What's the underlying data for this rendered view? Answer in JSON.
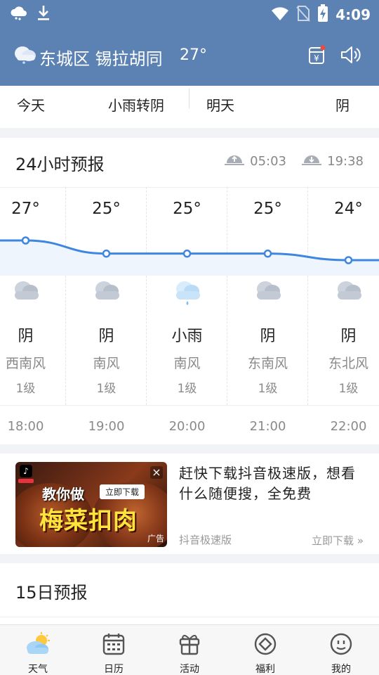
{
  "status_bar": {
    "time": "4:09",
    "icons": [
      "cloud-icon",
      "download-icon",
      "wifi-icon",
      "no-sim-icon",
      "battery-charging-icon"
    ]
  },
  "header": {
    "location": "东城区 锡拉胡同",
    "temperature": "27°",
    "icons": [
      "weather-cloud-icon",
      "lottery-icon",
      "speaker-icon"
    ]
  },
  "today_bar": {
    "today_label": "今天",
    "today_condition": "小雨转阴",
    "tomorrow_label": "明天",
    "tomorrow_condition": "阴"
  },
  "forecast_24h": {
    "title": "24小时预报",
    "sunrise": "05:03",
    "sunset": "19:38",
    "hours": [
      {
        "temp": "27°",
        "temp_value": 27,
        "icon": "overcast-icon",
        "condition": "阴",
        "wind": "西南风",
        "level": "1级",
        "time": "18:00"
      },
      {
        "temp": "25°",
        "temp_value": 25,
        "icon": "overcast-icon",
        "condition": "阴",
        "wind": "南风",
        "level": "1级",
        "time": "19:00"
      },
      {
        "temp": "25°",
        "temp_value": 25,
        "icon": "light-rain-icon",
        "condition": "小雨",
        "wind": "南风",
        "level": "1级",
        "time": "20:00"
      },
      {
        "temp": "25°",
        "temp_value": 25,
        "icon": "overcast-icon",
        "condition": "阴",
        "wind": "东南风",
        "level": "1级",
        "time": "21:00"
      },
      {
        "temp": "24°",
        "temp_value": 24,
        "icon": "overcast-icon",
        "condition": "阴",
        "wind": "东北风",
        "level": "1级",
        "time": "22:00"
      }
    ]
  },
  "ad": {
    "image_line1": "教你做",
    "image_button": "立即下载",
    "image_line2": "梅菜扣肉",
    "image_mark": "广告",
    "close": "×",
    "headline": "赶快下载抖音极速版，想看什么随便搜，全免费",
    "source": "抖音极速版",
    "cta": "立即下载 »"
  },
  "forecast_15d": {
    "title": "15日预报"
  },
  "nav": [
    {
      "label": "天气",
      "icon": "weather-tab-icon"
    },
    {
      "label": "日历",
      "icon": "calendar-icon"
    },
    {
      "label": "活动",
      "icon": "gift-icon"
    },
    {
      "label": "福利",
      "icon": "diamond-icon"
    },
    {
      "label": "我的",
      "icon": "profile-icon"
    }
  ],
  "colors": {
    "header_bg": "#5b82b3",
    "curve": "#3e86e0"
  }
}
